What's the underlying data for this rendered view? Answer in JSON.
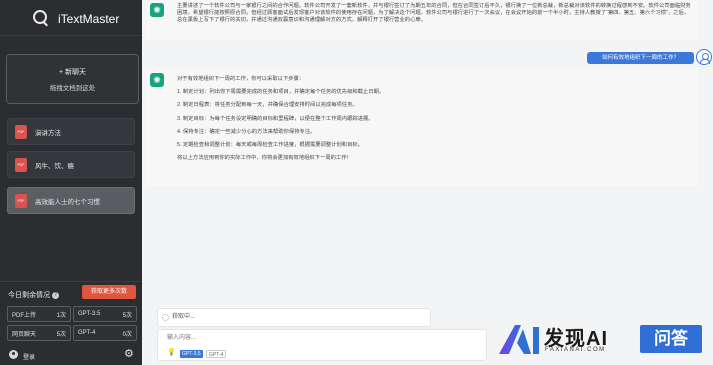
{
  "app": {
    "name": "iTextMaster"
  },
  "sidebar": {
    "new_chat": {
      "title": "+ 新聊天",
      "subtitle": "拖拽文档到这处"
    },
    "documents": [
      {
        "label": "演讲方法",
        "badge": "PDF"
      },
      {
        "label": "风牛、饮、瘾",
        "badge": "PDF"
      },
      {
        "label": "高效能人士的七个习惯",
        "badge": "PDF",
        "active": true
      }
    ],
    "quota": {
      "title": "今日剩余情况",
      "more_button": "获取更多次数",
      "cells": [
        {
          "label": "PDF上传",
          "value": "1次"
        },
        {
          "label": "GPT-3.5",
          "value": "5次"
        },
        {
          "label": "网页聊天",
          "value": "5次"
        },
        {
          "label": "GPT-4",
          "value": "0次"
        }
      ]
    },
    "user": {
      "label": "登录"
    }
  },
  "chat": {
    "messages": [
      {
        "role": "assistant",
        "paragraphs": [
          "主要讲述了一个软件公司与一家银行之间的合作问题。软件公司开发了一套新软件，并与银行签订了为期五年的合同，但在合同签订后不久，银行换了一位新总裁，新总裁对该软件的转换过程感到不安。软件公司面临财务困境，希望银行能按照原合同，但经过顾客面试后发现客户对该软件的使用存在问题，为了解决这个问题，软件公司与银行进行了一次会议，在会议开始的前一个半小时，主持人教授了“第四、第五、第六个习惯”，之后，总在黑板上写下了银行的关切，并通过沟通双赢意识和沟通理解对方的方式，解释打开了银行营业的心扉。"
        ]
      },
      {
        "role": "user",
        "text": "如何有效地组织下一周的工作？"
      },
      {
        "role": "assistant",
        "paragraphs": [
          "对于有效地组织下一周的工作，你可以采取以下步骤：",
          "1. 制定计划：列出你下周需要完成的任务和项目，并确定每个任务的优先级和截止日期。",
          "2. 制定日程表：将任务分配到每一天，并确保合理安排时间以完成每项任务。",
          "3. 制定目标：为每个任务设定明确的目标和里程碑，以便在整个工作周内跟踪进展。",
          "4. 保持专注：确定一些减少分心的方法来帮助你保持专注。",
          "5. 定期检查和调整计划：每天或每周检查工作进度，根据需要调整计划和目标。",
          "将以上方法应用到你的实际工作中，你将会更加有效地组织下一周的工作！"
        ]
      }
    ],
    "status": "获取中...",
    "input": {
      "placeholder": "输入内容..."
    },
    "models": [
      "GPT-3.5",
      "GPT-4"
    ]
  },
  "watermark": {
    "title": "发现AI",
    "subtitle": "FAXIANAI.COM",
    "tag": "问答"
  },
  "colors": {
    "sidebar": "#2b2d31",
    "accent": "#3c78d8",
    "bot": "#16a37f",
    "danger": "#e0553b"
  }
}
